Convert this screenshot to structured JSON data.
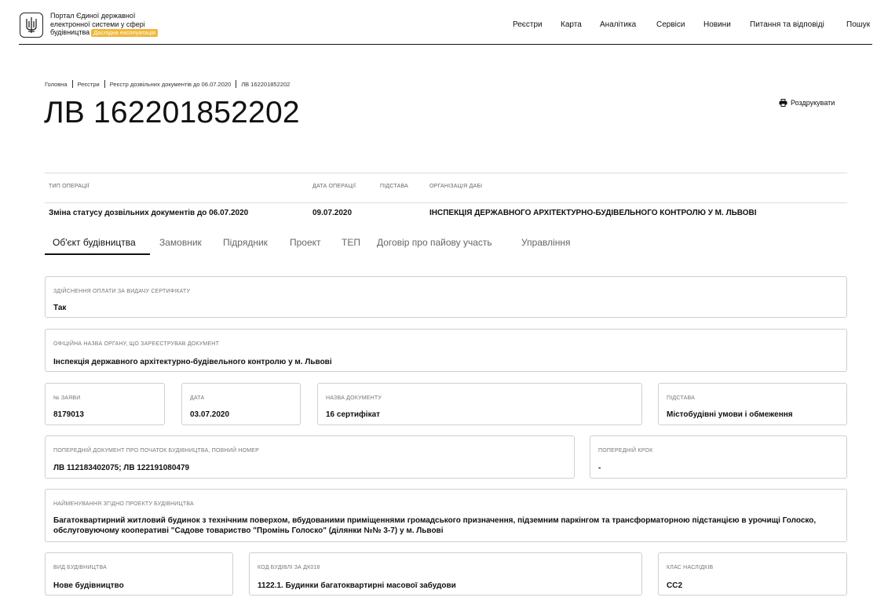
{
  "header": {
    "logo_icon": "trident-icon",
    "portal_title_line1": "Портал Єдиної державної",
    "portal_title_line2": "електронної системи у сфері",
    "portal_title_line3": "будівництва",
    "badge": "Дослідна експлуатація",
    "nav": [
      "Реєстри",
      "Карта",
      "Аналітика",
      "Сервіси",
      "Новини",
      "Питання та відповіді",
      "Пошук"
    ]
  },
  "breadcrumb": [
    "Головна",
    "Реєстри",
    "Реєстр дозвільних документів до 06.07.2020",
    "ЛВ 162201852202"
  ],
  "page_title": "ЛВ 162201852202",
  "print_label": "Роздрукувати",
  "operation": {
    "headers": [
      "Тип операції",
      "Дата операції",
      "Підстава",
      "Організація ДАБІ"
    ],
    "type": "Зміна статусу дозвільних документів до 06.07.2020",
    "date": "09.07.2020",
    "basis": "",
    "organization": "ІНСПЕКЦІЯ ДЕРЖАВНОГО АРХІТЕКТУРНО-БУДІВЕЛЬНОГО КОНТРОЛЮ У М. ЛЬВОВІ"
  },
  "tabs": [
    "Об'єкт будівництва",
    "Замовник",
    "Підрядник",
    "Проект",
    "ТЕП",
    "Договір про пайову участь",
    "Управління"
  ],
  "fields": {
    "payment": {
      "label": "Здійснення оплати за видачу сертифікату",
      "value": "Так"
    },
    "official_name": {
      "label": "Офіційна назва органу, що зареєстрував документ",
      "value": "Інспекція державного архітектурно-будівельного контролю у м. Львові"
    },
    "application_no": {
      "label": "№ заяви",
      "value": "8179013"
    },
    "date": {
      "label": "Дата",
      "value": "03.07.2020"
    },
    "doc_name": {
      "label": "Назва документу",
      "value": "16 сертифікат"
    },
    "basis": {
      "label": "Підстава",
      "value": "Містобудівні умови і обмеження"
    },
    "prev_doc": {
      "label": "Попередній документ про початок будівництва, повний номер",
      "value": "ЛВ 112183402075; ЛВ 122191080479"
    },
    "prev_step": {
      "label": "Попередній крок",
      "value": "-"
    },
    "project_name": {
      "label": "Найменування згідно проекту будівництва",
      "value": "Багатоквартирний житловий будинок з технічним поверхом, вбудованими приміщеннями громадського призначення, підземним паркінгом та трансформаторною підстанцією в урочищі Голоско, обслуговуючому кооперативі \"Садове товариство \"Промінь Голоско\" (ділянки №№ 3-7) у м. Львові"
    },
    "construction_type": {
      "label": "Вид будівництва",
      "value": "Нове будівництво"
    },
    "building_code": {
      "label": "Код будівлі за ДК018",
      "value": "1122.1. Будинки багатоквартирні масової забудови"
    },
    "consequence_class": {
      "label": "Клас наслідків",
      "value": "СС2"
    }
  }
}
